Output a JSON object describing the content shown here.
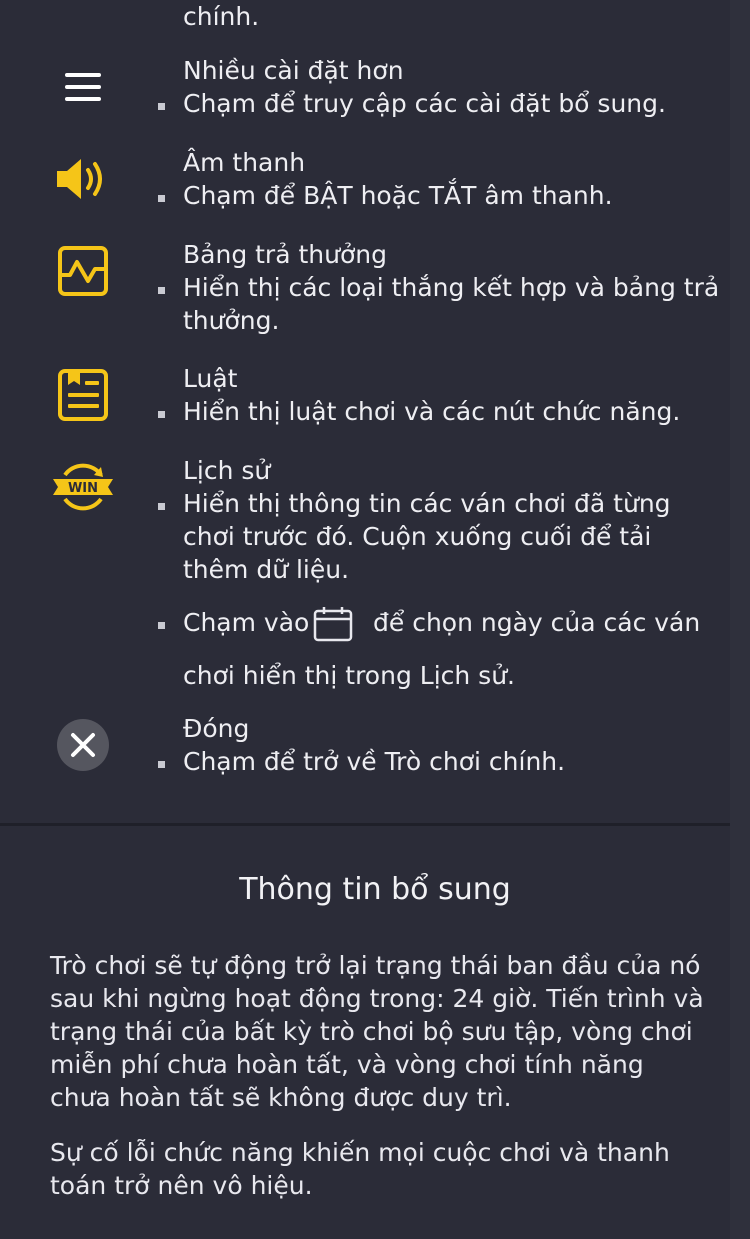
{
  "top_fragment": "chính.",
  "items": [
    {
      "icon": "menu-icon",
      "title": "Nhiều cài đặt hơn",
      "bullets": [
        "Chạm để truy cập các cài đặt bổ sung."
      ]
    },
    {
      "icon": "speaker-icon",
      "title": "Âm thanh",
      "bullets": [
        "Chạm để BẬT hoặc TẮT âm thanh."
      ]
    },
    {
      "icon": "paytable-icon",
      "title": "Bảng trả thưởng",
      "bullets": [
        "Hiển thị các loại thắng kết hợp và bảng trả thưởng."
      ]
    },
    {
      "icon": "rules-icon",
      "title": "Luật",
      "bullets": [
        "Hiển thị luật chơi và các nút chức năng."
      ]
    },
    {
      "icon": "win-history-icon",
      "title": "Lịch sử",
      "bullets": [
        "Hiển thị thông tin các ván chơi đã từng chơi trước đó. Cuộn xuống cuối để tải thêm dữ liệu."
      ],
      "calendar_prefix": "Chạm vào",
      "calendar_suffix": "để chọn ngày của các ván",
      "calendar_line2": "chơi hiển thị trong Lịch sử."
    },
    {
      "icon": "close-icon",
      "title": "Đóng",
      "bullets": [
        "Chạm để trở về Trò chơi chính."
      ]
    }
  ],
  "info": {
    "heading": "Thông tin bổ sung",
    "paragraphs": [
      "Trò chơi sẽ tự động trở lại trạng thái ban đầu của nó sau khi ngừng hoạt động trong: 24 giờ. Tiến trình và trạng thái của bất kỳ trò chơi bộ sưu tập, vòng chơi miễn phí chưa hoàn tất, và vòng chơi tính năng chưa hoàn tất sẽ không được duy trì.",
      "Sự cố lỗi chức năng khiến mọi cuộc chơi và thanh toán trở nên vô hiệu."
    ]
  },
  "colors": {
    "background": "#2b2c38",
    "accent": "#f5c518",
    "text": "#eeeef2",
    "close_circle": "#55565f"
  }
}
